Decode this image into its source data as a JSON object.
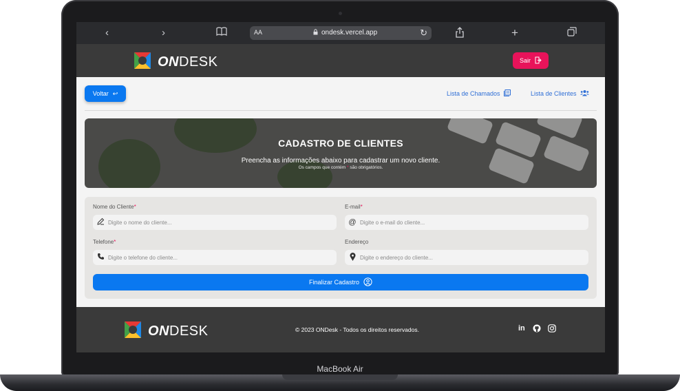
{
  "browser": {
    "aa_label": "AA",
    "url": "ondesk.vercel.app",
    "icons": [
      "back-icon",
      "forward-icon",
      "book-icon",
      "lock-icon",
      "reload-icon",
      "share-icon",
      "new-tab-icon",
      "tabs-icon"
    ]
  },
  "header": {
    "logo_bold": "ON",
    "logo_light": "DESK",
    "logout_label": "Sair"
  },
  "nav": {
    "back_label": "Voltar",
    "links": [
      "Lista de Chamados",
      "Lista de Clientes"
    ]
  },
  "hero": {
    "title": "CADASTRO DE CLIENTES",
    "subtitle": "Preencha as informações abaixo para cadastrar um novo cliente.",
    "note_before": "Os campos que contém ",
    "note_mark": "*",
    "note_after": " são obrigatórios."
  },
  "form": {
    "fields": [
      {
        "label": "Nome do Cliente",
        "required": "*",
        "placeholder": "Digite o nome do cliente..."
      },
      {
        "label": "E-mail",
        "required": "*",
        "placeholder": "Digite o e-mail do cliente..."
      },
      {
        "label": "Telefone",
        "required": "*",
        "placeholder": "Digite o telefone do cliente..."
      },
      {
        "label": "Endereço",
        "required": "",
        "placeholder": "Digite o endereço do cliente..."
      }
    ],
    "submit_label": "Finalizar Cadastro"
  },
  "footer": {
    "logo_bold": "ON",
    "logo_light": "DESK",
    "copyright": "© 2023 ONDesk - Todos os direitos reservados.",
    "social": [
      "in",
      "github",
      "instagram"
    ]
  },
  "device": {
    "label": "MacBook Air"
  },
  "colors": {
    "primary": "#0a78f0",
    "accent": "#e8135a",
    "header_bg": "#3a3a3a",
    "form_bg": "#e6e5e3"
  }
}
